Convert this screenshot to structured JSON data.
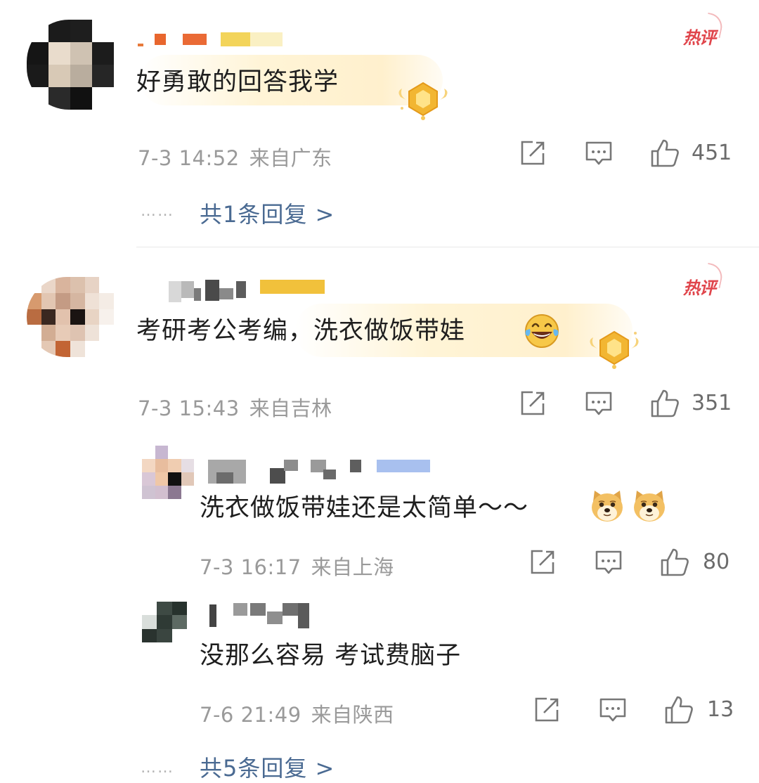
{
  "comments": [
    {
      "text": "好勇敢的回答我学",
      "date": "7-3 14:52",
      "location": "来自广东",
      "likes": "451",
      "badge": "热评",
      "replies_link": "共1条回复 >",
      "replies_dots": "……"
    },
    {
      "text": "考研考公考编，洗衣做饭带娃",
      "emoji": "😂",
      "date": "7-3 15:43",
      "location": "来自吉林",
      "likes": "351",
      "badge": "热评",
      "replies_link": "共5条回复 >",
      "replies_dots": "……",
      "replies": [
        {
          "text": "洗衣做饭带娃还是太简单～～",
          "emoji": "doge-icon doge-icon",
          "date": "7-3 16:17",
          "location": "来自上海",
          "likes": "80"
        },
        {
          "text": "没那么容易 考试费脑子",
          "date": "7-6 21:49",
          "location": "来自陕西",
          "likes": "13"
        }
      ]
    }
  ],
  "colors": {
    "hot_badge": "#e0454b",
    "link": "#4a6a92",
    "meta": "#9a9a9a",
    "medal": "#f2b632"
  }
}
